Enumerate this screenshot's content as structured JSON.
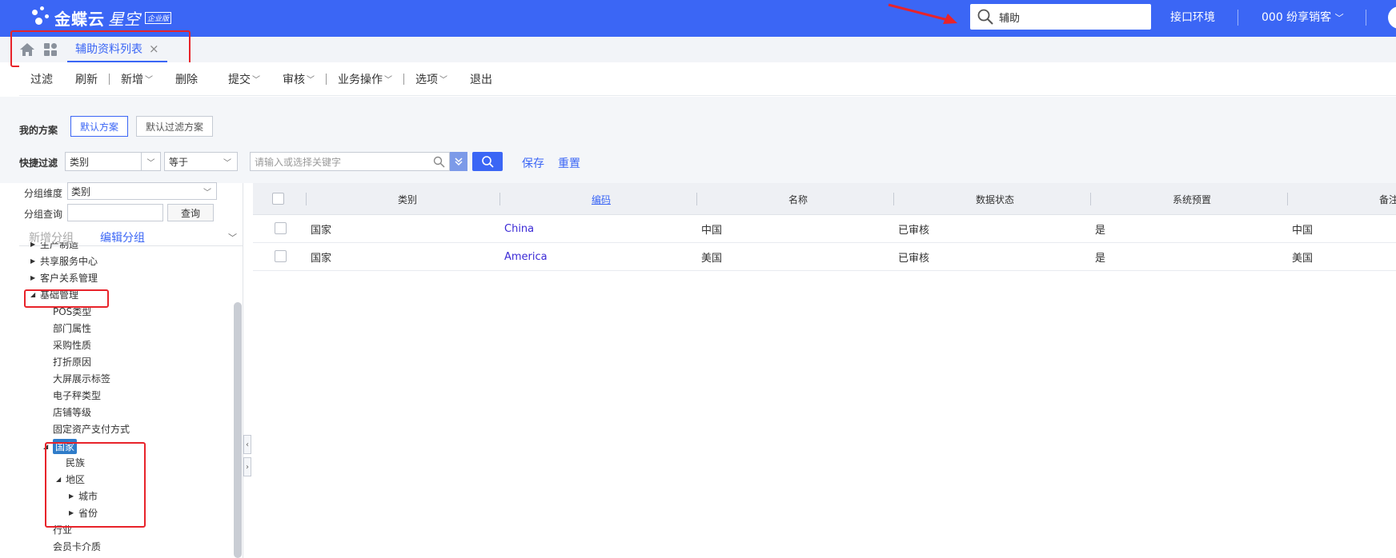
{
  "header": {
    "logo_text": "金蝶云",
    "logo_sub": "星空",
    "logo_badge": "企业版",
    "search_value": "辅助",
    "env_label": "接口环境",
    "org_label": "000 纷享销客",
    "brand_color": "#3b66f5"
  },
  "tabs": {
    "active_label": "辅助资料列表",
    "close": "×"
  },
  "toolbar": {
    "filter": "过滤",
    "refresh": "刷新",
    "add": "新增",
    "delete": "删除",
    "submit": "提交",
    "audit": "审核",
    "business": "业务操作",
    "options": "选项",
    "exit": "退出"
  },
  "filter": {
    "my_scheme_label": "我的方案",
    "default_scheme": "默认方案",
    "default_filter_scheme": "默认过滤方案",
    "quick_filter_label": "快捷过滤",
    "field_value": "类别",
    "operator_value": "等于",
    "keyword_placeholder": "请输入或选择关键字",
    "save": "保存",
    "reset": "重置"
  },
  "left_panel": {
    "group_dim_label": "分组维度",
    "group_dim_value": "类别",
    "group_query_label": "分组查询",
    "query_button": "查询",
    "add_group": "新增分组",
    "edit_group": "编辑分组",
    "tree": [
      {
        "label": "生产制造",
        "level": 1,
        "toggle": "▶"
      },
      {
        "label": "共享服务中心",
        "level": 1,
        "toggle": "▶"
      },
      {
        "label": "客户关系管理",
        "level": 1,
        "toggle": "▶"
      },
      {
        "label": "基础管理",
        "level": 1,
        "toggle": "◢"
      },
      {
        "label": "POS类型",
        "level": 2,
        "toggle": ""
      },
      {
        "label": "部门属性",
        "level": 2,
        "toggle": ""
      },
      {
        "label": "采购性质",
        "level": 2,
        "toggle": ""
      },
      {
        "label": "打折原因",
        "level": 2,
        "toggle": ""
      },
      {
        "label": "大屏展示标签",
        "level": 2,
        "toggle": ""
      },
      {
        "label": "电子秤类型",
        "level": 2,
        "toggle": ""
      },
      {
        "label": "店铺等级",
        "level": 2,
        "toggle": ""
      },
      {
        "label": "固定资产支付方式",
        "level": 2,
        "toggle": ""
      },
      {
        "label": "国家",
        "level": 2,
        "toggle": "◢",
        "selected": true
      },
      {
        "label": "民族",
        "level": 3,
        "toggle": ""
      },
      {
        "label": "地区",
        "level": 3,
        "toggle": "◢"
      },
      {
        "label": "城市",
        "level": 4,
        "toggle": "▶"
      },
      {
        "label": "省份",
        "level": 4,
        "toggle": "▶"
      },
      {
        "label": "行业",
        "level": 2,
        "toggle": ""
      },
      {
        "label": "会员卡介质",
        "level": 2,
        "toggle": ""
      }
    ]
  },
  "grid": {
    "columns": [
      "类别",
      "编码",
      "名称",
      "数据状态",
      "系统预置",
      "备注"
    ],
    "rows": [
      [
        "国家",
        "China",
        "中国",
        "已审核",
        "是",
        "中国"
      ],
      [
        "国家",
        "America",
        "美国",
        "已审核",
        "是",
        "美国"
      ]
    ]
  }
}
